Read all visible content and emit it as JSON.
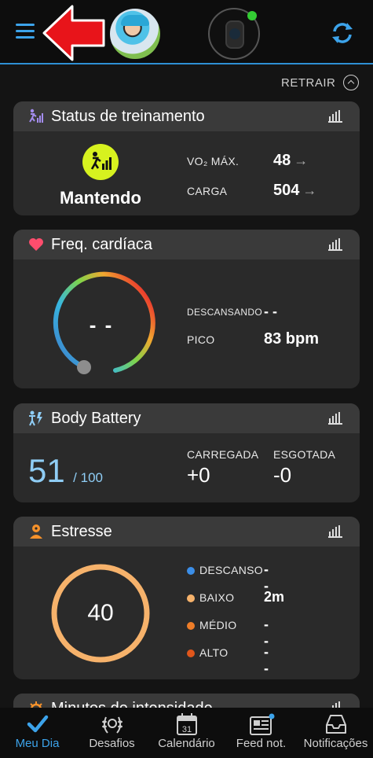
{
  "header": {
    "retrair_label": "RETRAIR"
  },
  "training": {
    "title": "Status de treinamento",
    "status": "Mantendo",
    "vo2_label": "VO₂ MÁX.",
    "vo2_value": "48",
    "load_label": "CARGA",
    "load_value": "504"
  },
  "heart": {
    "title": "Freq. cardíaca",
    "current": "- -",
    "resting_label": "DESCANSANDO",
    "resting_value": "- -",
    "peak_label": "PICO",
    "peak_value": "83 bpm"
  },
  "battery": {
    "title": "Body Battery",
    "value": "51",
    "max": "/ 100",
    "charged_label": "CARREGADA",
    "charged_value": "+0",
    "drained_label": "ESGOTADA",
    "drained_value": "-0"
  },
  "stress": {
    "title": "Estresse",
    "value": "40",
    "items": [
      {
        "label": "DESCANSO",
        "value": "- -",
        "color": "#3b8ee8"
      },
      {
        "label": "BAIXO",
        "value": "2m",
        "color": "#f6b26b"
      },
      {
        "label": "MÉDIO",
        "value": "- -",
        "color": "#ee7d28"
      },
      {
        "label": "ALTO",
        "value": "- -",
        "color": "#e0561b"
      }
    ]
  },
  "intensity": {
    "title": "Minutos de intensidade"
  },
  "colors": {
    "accent": "#3ca3ea",
    "training_badge": "#d7f21f",
    "heart_icon": "#ff4d6d",
    "stress_ring": "#f6b26b",
    "battery_value": "#8fcdf5"
  },
  "nav": {
    "items": [
      {
        "label": "Meu Dia",
        "icon": "check-icon"
      },
      {
        "label": "Desafios",
        "icon": "laurel-icon"
      },
      {
        "label": "Calendário",
        "icon": "calendar-icon"
      },
      {
        "label": "Feed not.",
        "icon": "news-icon"
      },
      {
        "label": "Notificações",
        "icon": "inbox-icon"
      }
    ]
  }
}
